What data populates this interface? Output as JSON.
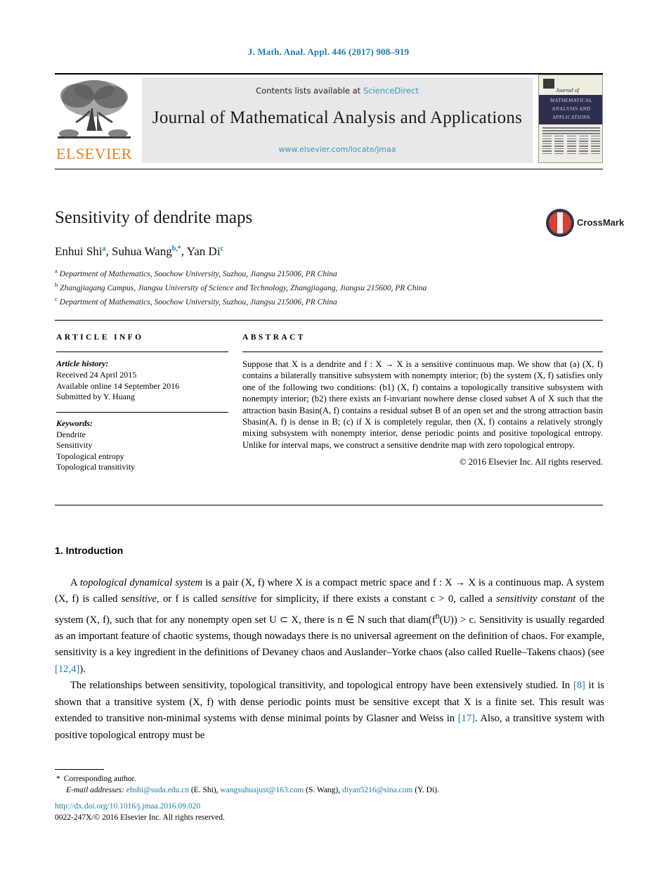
{
  "running_head": "J. Math. Anal. Appl. 446 (2017) 908–919",
  "masthead": {
    "contents_prefix": "Contents lists available at ",
    "sciencedirect": "ScienceDirect",
    "journal_title": "Journal of Mathematical Analysis and Applications",
    "journal_url": "www.elsevier.com/locate/jmaa",
    "publisher_wordmark": "ELSEVIER",
    "cover": {
      "journal_of": "Journal of",
      "band_line1": "MATHEMATICAL",
      "band_line2": "ANALYSIS AND",
      "band_line3": "APPLICATIONS"
    }
  },
  "title": "Sensitivity of dendrite maps",
  "crossmark_label": "CrossMark",
  "authors": [
    {
      "name": "Enhui Shi",
      "marks": "a"
    },
    {
      "name": "Suhua Wang",
      "marks": "b,*"
    },
    {
      "name": "Yan Di",
      "marks": "c"
    }
  ],
  "affiliations": [
    {
      "mark": "a",
      "text": "Department of Mathematics, Soochow University, Suzhou, Jiangsu 215006, PR China"
    },
    {
      "mark": "b",
      "text": "Zhangjiagang Campus, Jiangsu University of Science and Technology, Zhangjiagang, Jiangsu 215600, PR China"
    },
    {
      "mark": "c",
      "text": "Department of Mathematics, Soochow University, Suzhou, Jiangsu 215006, PR China"
    }
  ],
  "article_info": {
    "heading": "ARTICLE INFO",
    "history_label": "Article history:",
    "history": [
      "Received 24 April 2015",
      "Available online 14 September 2016",
      "Submitted by Y. Huang"
    ],
    "keywords_label": "Keywords:",
    "keywords": [
      "Dendrite",
      "Sensitivity",
      "Topological entropy",
      "Topological transitivity"
    ]
  },
  "abstract": {
    "heading": "ABSTRACT",
    "text": "Suppose that X is a dendrite and f : X → X is a sensitive continuous map. We show that (a) (X, f) contains a bilaterally transitive subsystem with nonempty interior; (b) the system (X, f) satisfies only one of the following two conditions: (b1) (X, f) contains a topologically transitive subsystem with nonempty interior; (b2) there exists an f-invariant nowhere dense closed subset A of X such that the attraction basin Basin(A, f) contains a residual subset B of an open set and the strong attraction basin Sbasin(A, f) is dense in B; (c) if X is completely regular, then (X, f) contains a relatively strongly mixing subsystem with nonempty interior, dense periodic points and positive topological entropy. Unlike for interval maps, we construct a sensitive dendrite map with zero topological entropy.",
    "copyright": "© 2016 Elsevier Inc. All rights reserved."
  },
  "section": {
    "heading": "1. Introduction",
    "paragraph1_a": "A ",
    "paragraph1_em1": "topological dynamical system",
    "paragraph1_b": " is a pair (X, f) where X is a compact metric space and f : X → X is a continuous map. A system (X, f) is called ",
    "paragraph1_em2": "sensitive",
    "paragraph1_c": ", or f is called ",
    "paragraph1_em3": "sensitive",
    "paragraph1_d": " for simplicity, if there exists a constant c > 0, called a ",
    "paragraph1_em4": "sensitivity constant",
    "paragraph1_e": " of the system (X, f), such that for any nonempty open set U ⊂ X, there is n ∈ N such that diam(f",
    "paragraph1_sup": "n",
    "paragraph1_f": "(U)) > c. Sensitivity is usually regarded as an important feature of chaotic systems, though nowadays there is no universal agreement on the definition of chaos. For example, sensitivity is a key ingredient in the definitions of Devaney chaos and Auslander–Yorke chaos (also called Ruelle–Takens chaos) (see ",
    "paragraph1_cite": "[12,4]",
    "paragraph1_g": ").",
    "paragraph2_a": "The relationships between sensitivity, topological transitivity, and topological entropy have been extensively studied. In ",
    "paragraph2_cite1": "[8]",
    "paragraph2_b": " it is shown that a transitive system (X, f) with dense periodic points must be sensitive except that X is a finite set. This result was extended to transitive non-minimal systems with dense minimal points by Glasner and Weiss in ",
    "paragraph2_cite2": "[17]",
    "paragraph2_c": ". Also, a transitive system with positive topological entropy must be"
  },
  "footnotes": {
    "corresponding": "Corresponding author.",
    "email_label": "E-mail addresses:",
    "emails": [
      {
        "address": "ehshi@suda.edu.cn",
        "owner": "(E. Shi)"
      },
      {
        "address": "wangsuhuajust@163.com",
        "owner": "(S. Wang)"
      },
      {
        "address": "diyan5216@sina.com",
        "owner": "(Y. Di)."
      }
    ],
    "doi": "http://dx.doi.org/10.1016/j.jmaa.2016.09.020",
    "issn_line": "0022-247X/© 2016 Elsevier Inc. All rights reserved."
  }
}
